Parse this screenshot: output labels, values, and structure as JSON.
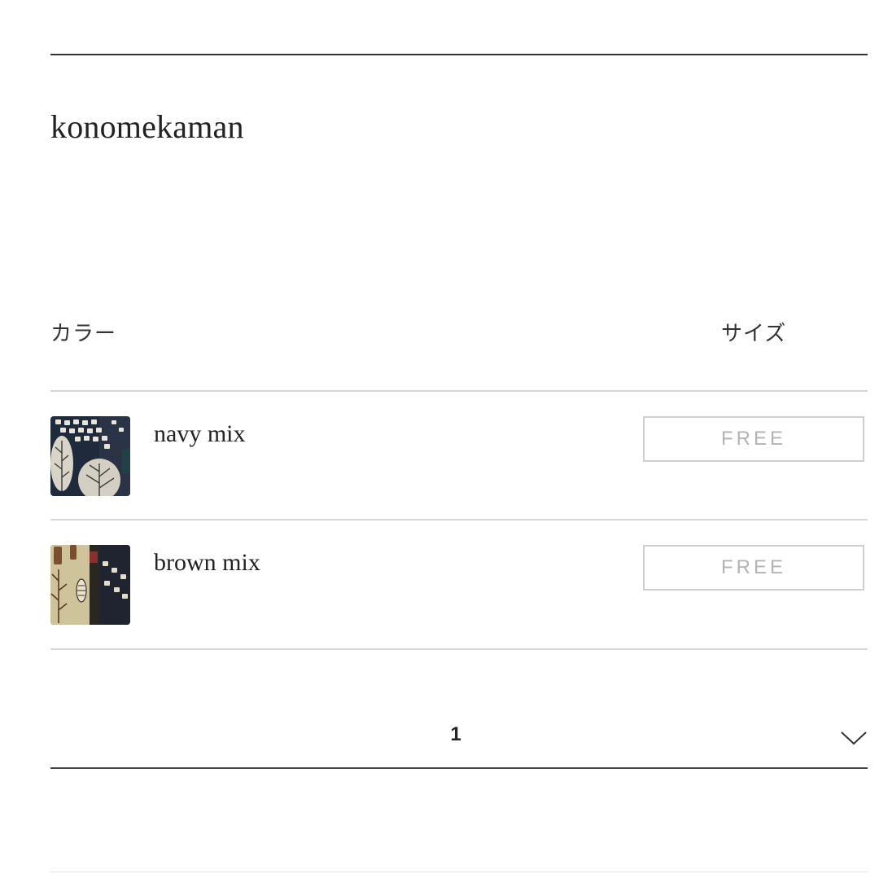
{
  "brand": {
    "name": "konomekaman"
  },
  "headers": {
    "color": "カラー",
    "size": "サイズ"
  },
  "variants": [
    {
      "color_label": "navy mix",
      "size_label": "FREE",
      "swatch_icon": "navy-mix-swatch"
    },
    {
      "color_label": "brown mix",
      "size_label": "FREE",
      "swatch_icon": "brown-mix-swatch"
    }
  ],
  "quantity": {
    "value": "1",
    "icon": "chevron-down-icon"
  },
  "colors": {
    "rule_dark": "#333333",
    "rule_light": "#d6d6d6",
    "size_button_border": "#cfcfcf",
    "size_button_text": "#b3b3b3"
  }
}
